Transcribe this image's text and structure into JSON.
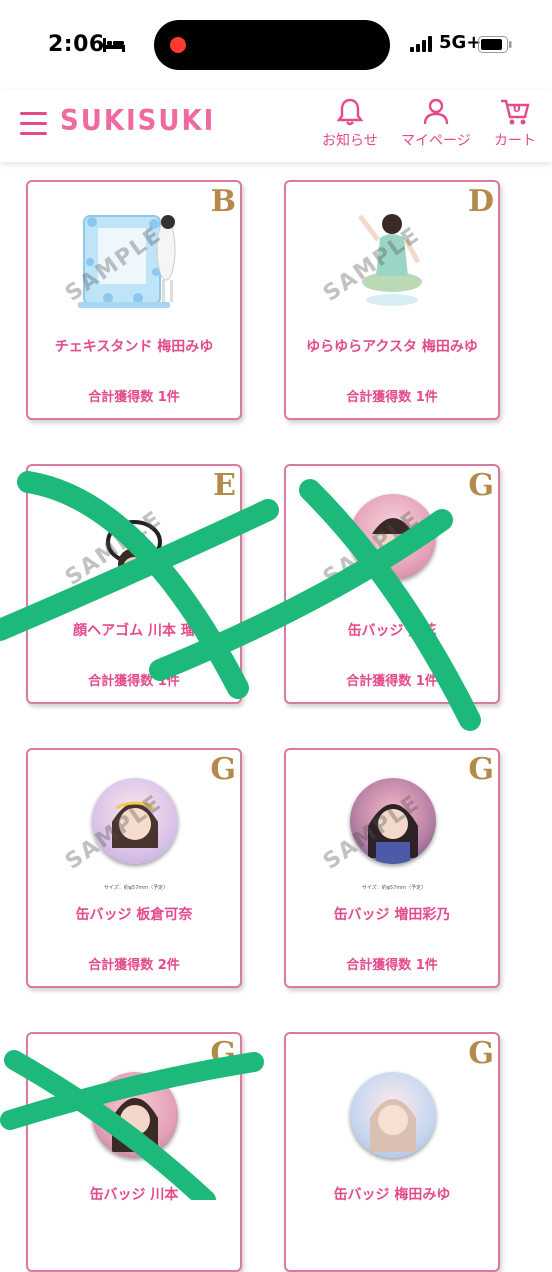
{
  "status_bar": {
    "time": "2:06",
    "network": "5G+"
  },
  "header": {
    "logo": "SUKISUKI",
    "notifications_label": "お知らせ",
    "mypage_label": "マイページ",
    "cart_label": "カート",
    "cart_count": "0"
  },
  "cards": [
    {
      "grade": "B",
      "name": "チェキスタンド 梅田みゆ",
      "count": "合計獲得数 1件",
      "watermark": "SAMPLE"
    },
    {
      "grade": "D",
      "name": "ゆらゆらアクスタ 梅田みゆ",
      "count": "合計獲得数 1件",
      "watermark": "SAMPLE"
    },
    {
      "grade": "E",
      "name": "顔ヘアゴム 川本 瑠",
      "count": "合計獲得数 1件",
      "watermark": "SAMPLE"
    },
    {
      "grade": "G",
      "name": "缶バッジ 愛花",
      "count": "合計獲得数 1件",
      "watermark": "SAMPLE"
    },
    {
      "grade": "G",
      "name": "缶バッジ 板倉可奈",
      "count": "合計獲得数 2件",
      "watermark": "SAMPLE",
      "size_note": "サイズ：約φ57mm（予定）"
    },
    {
      "grade": "G",
      "name": "缶バッジ 増田彩乃",
      "count": "合計獲得数 1件",
      "watermark": "SAMPLE",
      "size_note": "サイズ：約φ57mm（予定）"
    },
    {
      "grade": "G",
      "name": "缶バッジ 川本",
      "count": "",
      "watermark": ""
    },
    {
      "grade": "G",
      "name": "缶バッジ 梅田みゆ",
      "count": "",
      "watermark": ""
    }
  ],
  "colors": {
    "accent": "#e44b8c",
    "gold": "#b48a4c",
    "scribble": "#1db97a"
  }
}
